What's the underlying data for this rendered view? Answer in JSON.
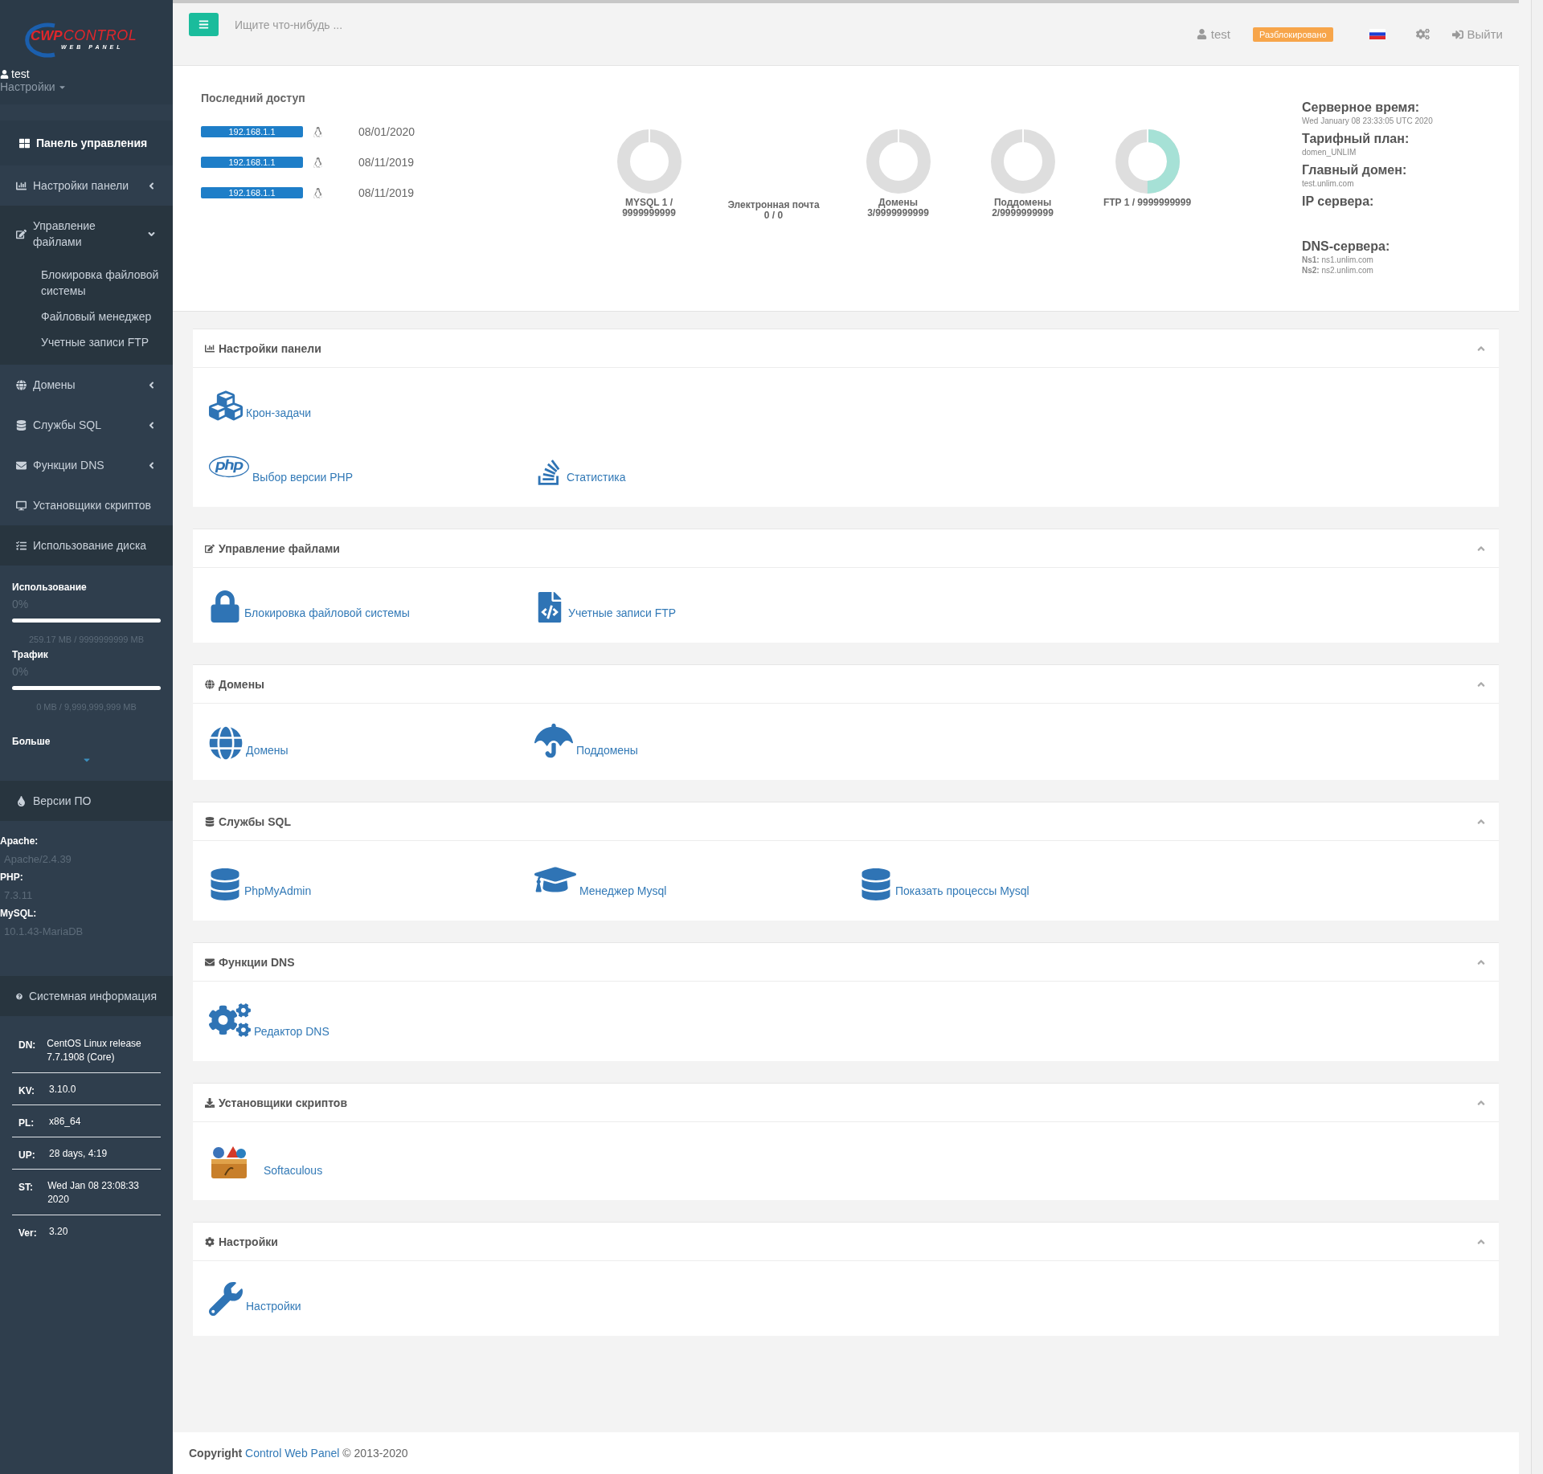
{
  "logo": {
    "brand": "CWP",
    "name": "CONTROL",
    "tagline": "WEB PANEL"
  },
  "sidebar": {
    "user": "test",
    "settings_menu": "Настройки",
    "nav": [
      {
        "label": "Панель управления",
        "selected": true
      },
      {
        "label": "Настройки панели",
        "selected": false,
        "expanded": false
      },
      {
        "label": "Управление файлами",
        "selected": false,
        "expanded": true,
        "children": [
          {
            "label": "Блокировка файловой системы"
          },
          {
            "label": "Файловый менеджер"
          },
          {
            "label": "Учетные записи FTP"
          }
        ]
      },
      {
        "label": "Домены",
        "selected": false,
        "expanded": false
      },
      {
        "label": "Службы SQL",
        "selected": false,
        "expanded": false
      },
      {
        "label": "Функции DNS",
        "selected": false,
        "expanded": false
      },
      {
        "label": "Установщики скриптов",
        "selected": false
      },
      {
        "label": "Использование диска",
        "selected": false
      }
    ],
    "usage": [
      {
        "label": "Использование",
        "reading": "0%",
        "level": 0,
        "detail": "259.17 MB / 9999999999 MB"
      },
      {
        "label": "Трафик",
        "reading": "0%",
        "level": 0,
        "detail": "0 MB / 9,999,999,999 MB"
      }
    ],
    "more": "Больше",
    "versions_title": "Версии ПО",
    "versions": [
      {
        "label": "Apache:",
        "value": "Apache/2.4.39"
      },
      {
        "label": "PHP:",
        "value": "7.3.11"
      },
      {
        "label": "MySQL:",
        "value": "10.1.43-MariaDB"
      }
    ],
    "system_title": "Системная информация",
    "system": [
      {
        "key": "DN:",
        "value": "CentOS Linux release 7.7.1908 (Core)"
      },
      {
        "key": "KV:",
        "value": "3.10.0"
      },
      {
        "key": "PL:",
        "value": "x86_64"
      },
      {
        "key": "UP:",
        "value": "28 days, 4:19"
      },
      {
        "key": "ST:",
        "value": "Wed Jan 08 23:08:33 2020"
      },
      {
        "key": "Ver:",
        "value": "3.20"
      }
    ]
  },
  "header": {
    "search": {
      "placeholder": "Ищите что-нибудь ..."
    },
    "user": "test",
    "badge": "Разблокировано",
    "logout": "Выйти"
  },
  "last_access": {
    "title": "Последний доступ",
    "rows": [
      {
        "ip": "192.168.1.1",
        "date": "08/01/2020"
      },
      {
        "ip": "192.168.1.1",
        "date": "08/11/2019"
      },
      {
        "ip": "192.168.1.1",
        "date": "08/11/2019"
      }
    ]
  },
  "stats": [
    {
      "kind": "donut",
      "label": "MYSQL 1 /\n9999999999",
      "level": 0
    },
    {
      "kind": "text",
      "label": "Электронная почта\n0 / 0"
    },
    {
      "kind": "donut",
      "label": "Домены\n3/9999999999",
      "level": 0
    },
    {
      "kind": "donut",
      "label": "Поддомены\n2/9999999999",
      "level": 0
    },
    {
      "kind": "donut",
      "label": "FTP 1 / 9999999999",
      "level": 0.5
    }
  ],
  "server_info": [
    {
      "label": "Серверное время:",
      "value": "Wed January 08 23:33:05 UTC 2020"
    },
    {
      "label": "Тарифный план:",
      "value": "domen_UNLIM"
    },
    {
      "label": "Главный домен:",
      "value": "test.unlim.com"
    },
    {
      "label": "IP сервера:"
    },
    {
      "label": "DNS-сервера:",
      "lines": [
        "**Ns1:** ns1.unlim.com",
        "**Ns2:** ns2.unlim.com"
      ]
    }
  ],
  "sections": [
    {
      "title": "Настройки панели",
      "expanded": true,
      "rows": [
        [
          {
            "label": "Крон-задачи"
          }
        ],
        [
          {
            "label": "Выбор версии PHP"
          },
          {
            "label": "Статистика"
          }
        ]
      ]
    },
    {
      "title": "Управление файлами",
      "expanded": true,
      "rows": [
        [
          {
            "label": "Блокировка файловой системы"
          },
          {
            "label": "Учетные записи FTP"
          }
        ]
      ]
    },
    {
      "title": "Домены",
      "expanded": true,
      "rows": [
        [
          {
            "label": "Домены"
          },
          {
            "label": "Поддомены"
          }
        ]
      ]
    },
    {
      "title": "Службы SQL",
      "expanded": true,
      "rows": [
        [
          {
            "label": "PhpMyAdmin"
          },
          {
            "label": "Менеджер Mysql"
          },
          {
            "label": "Показать процессы Mysql"
          }
        ]
      ]
    },
    {
      "title": "Функции DNS",
      "expanded": true,
      "rows": [
        [
          {
            "label": "Редактор DNS"
          }
        ]
      ]
    },
    {
      "title": "Установщики скриптов",
      "expanded": true,
      "rows": [
        [
          {
            "label": "Softaculous"
          }
        ]
      ]
    },
    {
      "title": "Настройки",
      "expanded": true,
      "rows": [
        [
          {
            "label": "Настройки"
          }
        ]
      ]
    }
  ],
  "footer": {
    "prefix": "Copyright",
    "link": "Control Web Panel",
    "suffix": "© 2013-2020"
  }
}
